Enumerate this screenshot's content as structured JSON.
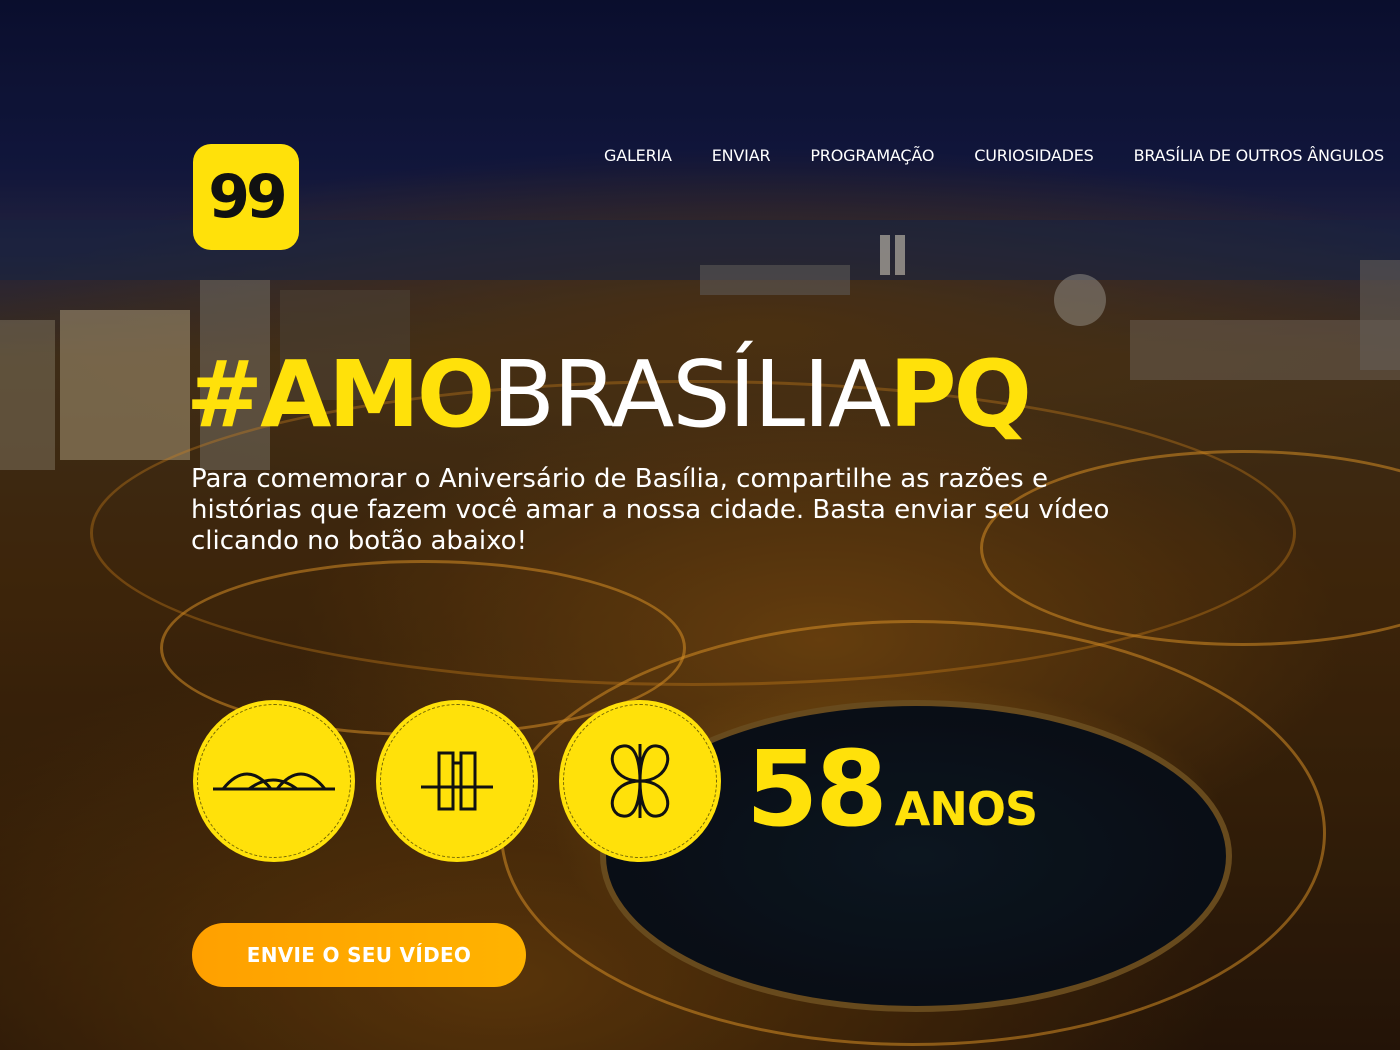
{
  "brand": {
    "logo_text": "99",
    "accent_color": "#ffe10a",
    "button_color": "#ffa000"
  },
  "nav": {
    "items": [
      {
        "label": "GALERIA"
      },
      {
        "label": "ENVIAR"
      },
      {
        "label": "PROGRAMAÇÃO"
      },
      {
        "label": "CURIOSIDADES"
      },
      {
        "label": "BRASÍLIA DE OUTROS ÂNGULOS"
      }
    ]
  },
  "hero": {
    "headline": {
      "part1": "#AMO",
      "part2": "BRASÍLIA",
      "part3": "PQ"
    },
    "intro": "Para comemorar o Aniversário de Basília, compartilhe as razões e histórias que fazem você amar a nossa cidade. Basta enviar seu vídeo clicando no botão abaixo!",
    "icons": [
      {
        "name": "bridge-icon"
      },
      {
        "name": "congress-icon"
      },
      {
        "name": "palace-icon"
      }
    ],
    "age_number": "58",
    "age_unit": "ANOS",
    "cta_label": "ENVIE O SEU VÍDEO"
  }
}
